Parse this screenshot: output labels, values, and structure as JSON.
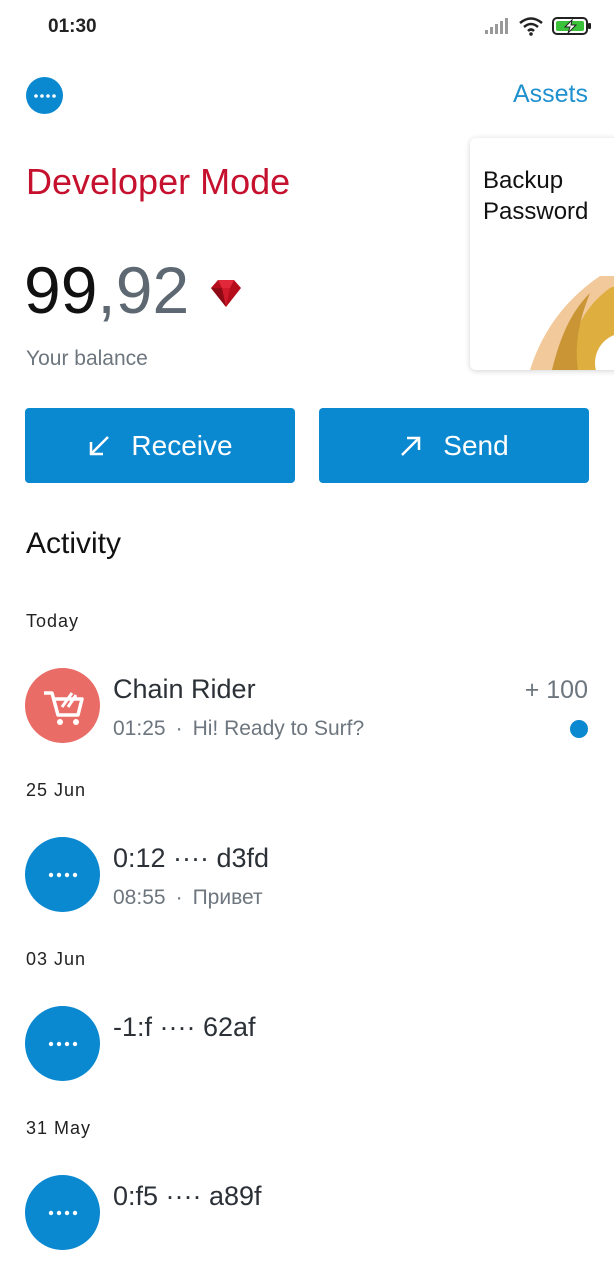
{
  "status_bar": {
    "time": "01:30"
  },
  "header": {
    "menu_icon": "dots-icon",
    "assets_label": "Assets"
  },
  "wallet": {
    "mode_label": "Developer Mode",
    "balance_int": "99",
    "balance_dec": ",92",
    "balance_label": "Your balance",
    "currency_icon": "ruby-gem-icon"
  },
  "backup_card": {
    "title": "Backup Password"
  },
  "actions": {
    "receive_label": "Receive",
    "send_label": "Send"
  },
  "activity": {
    "title": "Activity",
    "groups": [
      {
        "date": "Today",
        "items": [
          {
            "name": "Chain Rider",
            "time": "01:25",
            "message": "Hi! Ready to Surf?",
            "amount": "+ 100",
            "unread": true,
            "avatar": "cart-icon"
          }
        ]
      },
      {
        "date": "25 Jun",
        "items": [
          {
            "name": "0:12 ···· d3fd",
            "time": "08:55",
            "message": "Привет",
            "avatar": "dots-icon"
          }
        ]
      },
      {
        "date": "03 Jun",
        "items": [
          {
            "name": "-1:f ···· 62af",
            "avatar": "dots-icon"
          }
        ]
      },
      {
        "date": "31 May",
        "items": [
          {
            "name": "0:f5 ···· a89f",
            "avatar": "dots-icon"
          }
        ]
      }
    ]
  },
  "colors": {
    "accent": "#0a88d0",
    "dev_red": "#c5112e",
    "avatar_red": "#ea6c67"
  }
}
